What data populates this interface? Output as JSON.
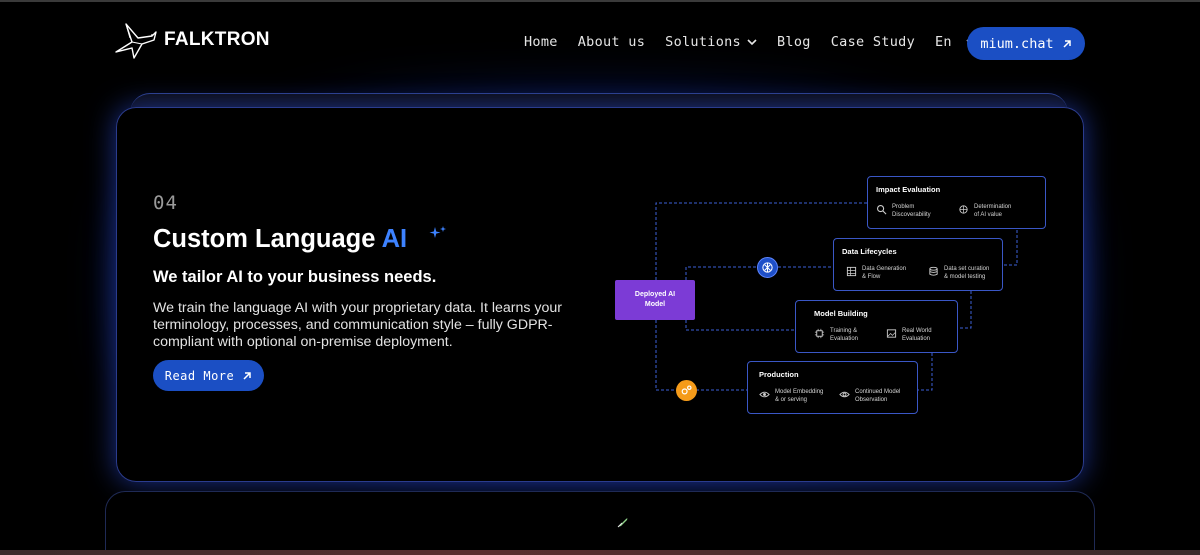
{
  "brand": {
    "name": "FALKTRON"
  },
  "nav": {
    "items": [
      {
        "label": "Home"
      },
      {
        "label": "About us"
      },
      {
        "label": "Solutions",
        "dropdown": true
      },
      {
        "label": "Blog"
      },
      {
        "label": "Case Study"
      },
      {
        "label": "En",
        "dropdown": true
      }
    ],
    "cta": "mium.chat"
  },
  "hero": {
    "number": "04",
    "title": "Custom Language",
    "title_highlight": "AI",
    "subtitle": "We tailor AI to your business needs.",
    "description": "We train the language AI with your proprietary data. It learns your terminology, processes, and communication style – fully GDPR-compliant with optional on-premise deployment.",
    "button": "Read More"
  },
  "diagram": {
    "deployed": "Deployed AI\nModel",
    "boxes": {
      "impact": {
        "title": "Impact Evaluation",
        "items": [
          "Problem\nDiscoverability",
          "Determination\nof AI value"
        ]
      },
      "lifecycle": {
        "title": "Data Lifecycles",
        "items": [
          "Data Generation\n& Flow",
          "Data set curation\n& model testing"
        ]
      },
      "building": {
        "title": "Model Building",
        "items": [
          "Training &\nEvaluation",
          "Real World\nEvaluation"
        ]
      },
      "production": {
        "title": "Production",
        "items": [
          "Model Embedding\n& or serving",
          "Continued Model\nObservation"
        ]
      }
    }
  },
  "colors": {
    "accent_blue": "#1b4fc4",
    "ai_highlight": "#3d82ff",
    "deployed_purple": "#7c3bd6",
    "gear_orange": "#f59b1a"
  }
}
